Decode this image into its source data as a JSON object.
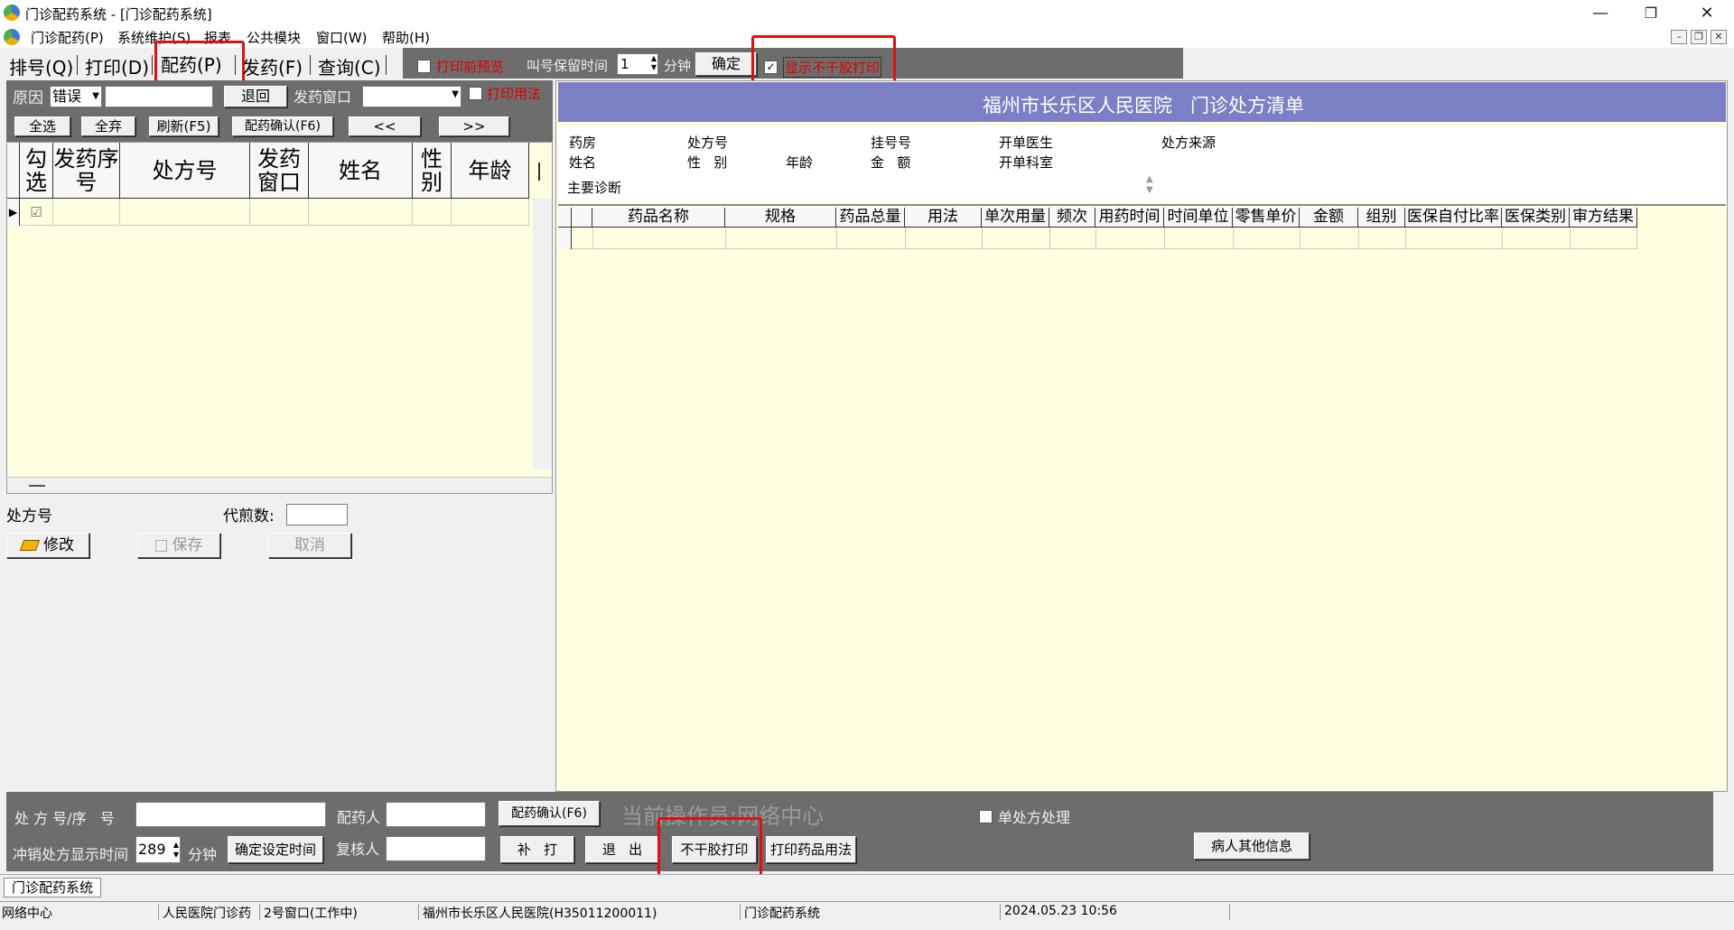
{
  "window": {
    "title": "门诊配药系统 - [门诊配药系统]",
    "controls": {
      "minimize": "—",
      "restore": "❐",
      "close": "✕"
    },
    "mdi_controls": {
      "minimize": "–",
      "restore": "❐",
      "close": "✕"
    }
  },
  "menubar": [
    "门诊配药(P)",
    "系统维护(S)",
    "报表",
    "公共模块",
    "窗口(W)",
    "帮助(H)"
  ],
  "toolbar": {
    "tabs": [
      "排号(Q)",
      "打印(D)",
      "配药(P)",
      "发药(F)",
      "查询(C)"
    ],
    "print_preview_label": "打印前预览",
    "call_keep_time_label": "叫号保留时间",
    "call_keep_time_value": "1",
    "minute_label": "分钟",
    "confirm_label": "确定",
    "show_no_glue_print_label": "显示不干胶打印",
    "show_no_glue_print_checked": "✓"
  },
  "left_filter": {
    "reason_label": "原因",
    "reason_value": "错误",
    "return_label": "退回",
    "window_label": "发药窗口",
    "print_usage_label": "打印用法",
    "buttons": [
      "全选",
      "全弃",
      "刷新(F5)",
      "配药确认(F6)",
      "<<",
      ">>"
    ]
  },
  "left_grid": {
    "headers": [
      "勾选",
      "发药序号",
      "处方号",
      "发药窗口",
      "姓名",
      "性别",
      "年龄"
    ],
    "row_marker": "▶",
    "row_check": "☑"
  },
  "left_form": {
    "rx_label": "处方号",
    "decoct_label": "代煎数:",
    "modify_label": "修改",
    "save_label": "保存",
    "cancel_label": "取消"
  },
  "prescription": {
    "hospital": "福州市长乐区人民医院",
    "title": "门诊处方清单",
    "fields": {
      "pharmacy": "药房",
      "rx_no": "处方号",
      "reg_no": "挂号号",
      "doctor": "开单医生",
      "rx_source": "处方来源",
      "name": "姓名",
      "gender": "性   别",
      "age": "年龄",
      "amount": "金   额",
      "dept": "开单科室",
      "diagnosis": "主要诊断"
    },
    "columns": [
      "药品名称",
      "规格",
      "药品总量",
      "用法",
      "单次用量",
      "频次",
      "用药时间",
      "时间单位",
      "零售单价",
      "金额",
      "组别",
      "医保自付比率",
      "医保类别",
      "审方结果"
    ]
  },
  "bottom": {
    "rx_seq_label": "处 方 号/序   号",
    "dispenser_label": "配药人",
    "confirm_label": "配药确认(F6)",
    "operator_label": "当前操作员:网络中心",
    "single_rx_label": "单处方处理",
    "offset_label": "冲销处方显示时间",
    "offset_value": "289",
    "minute_label": "分钟",
    "set_time_label": "确定设定时间",
    "reviewer_label": "复核人",
    "reprint_label": "补   打",
    "exit_label": "退   出",
    "no_glue_print_label": "不干胶打印",
    "print_usage_label": "打印药品用法",
    "patient_info_label": "病人其他信息"
  },
  "tabstrip": {
    "tab": "门诊配药系统"
  },
  "status": [
    "网络中心",
    "人民医院门诊药",
    "2号窗口(工作中)",
    "福州市长乐区人民医院(H35011200011)",
    "门诊配药系统",
    "2024.05.23 10:56"
  ]
}
